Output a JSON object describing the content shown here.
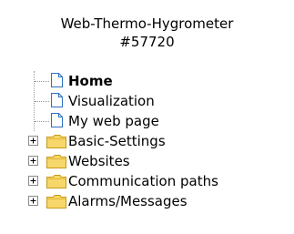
{
  "header": {
    "line1": "Web-Thermo-Hygrometer",
    "line2": "#57720"
  },
  "tree": {
    "items": [
      {
        "label": "Home",
        "type": "page"
      },
      {
        "label": "Visualization",
        "type": "page"
      },
      {
        "label": "My web page",
        "type": "page"
      },
      {
        "label": "Basic-Settings",
        "type": "folder"
      },
      {
        "label": "Websites",
        "type": "folder"
      },
      {
        "label": "Communication paths",
        "type": "folder"
      },
      {
        "label": "Alarms/Messages",
        "type": "folder"
      }
    ]
  },
  "colors": {
    "folder_fill": "#f7d76b",
    "folder_stroke": "#c79a16",
    "page_stroke": "#2e6fbf",
    "tree_line": "#9a9a9a"
  }
}
